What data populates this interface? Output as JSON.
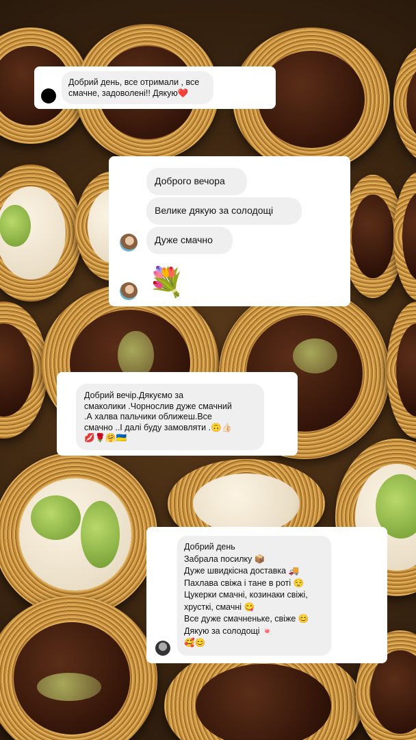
{
  "messages": {
    "m1": {
      "text": "Добрий день, все отримали , все\nсмачне, задоволені!! Дякую❤️"
    },
    "m2": {
      "lines": [
        "Доброго вечора",
        "Велике дякую за солодощі",
        "Дуже смачно"
      ],
      "flowers": "💐"
    },
    "m3": {
      "text": "Добрий вечір.Дякуємо за\nсмаколики .Чорнослив дуже смачний\n.А халва пальчики оближеш.Все\nсмачно ..І далі буду замовляти .🙃👍🏻\n💋🌹🤗🇺🇦"
    },
    "m4": {
      "text": "Добрий день\nЗабрала посилку 📦\nДуже швидкісна доставка 🚚\nПахлава свіжа і тане в роті 😌\nЦукерки смачні, козинаки свіжі,\nхрусткі, смачні 😋\nВсе дуже смачненьке, свіже 😊\nДякую за солодощі 🍬\n🥰😊"
    }
  },
  "background": {
    "description_colors": {
      "pastry": "#c9943f",
      "chocolate": "#341509",
      "cream": "#f3e9d6"
    }
  }
}
